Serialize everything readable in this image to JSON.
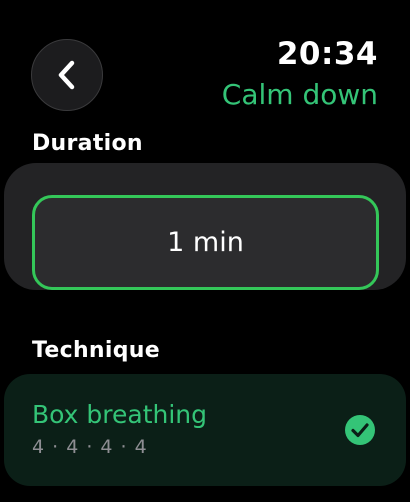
{
  "header": {
    "back_icon": "chevron-left-icon",
    "time": "20:34",
    "title": "Calm down"
  },
  "duration": {
    "label": "Duration",
    "value": "1 min"
  },
  "technique": {
    "label": "Technique",
    "selected": {
      "name": "Box breathing",
      "pattern": "4 · 4 · 4 · 4",
      "icon": "checkmark-circle-icon"
    }
  },
  "colors": {
    "accent": "#34c759",
    "accent_text": "#34c477",
    "background": "#000000",
    "card": "#232325",
    "selected_card": "#0b1f17"
  }
}
